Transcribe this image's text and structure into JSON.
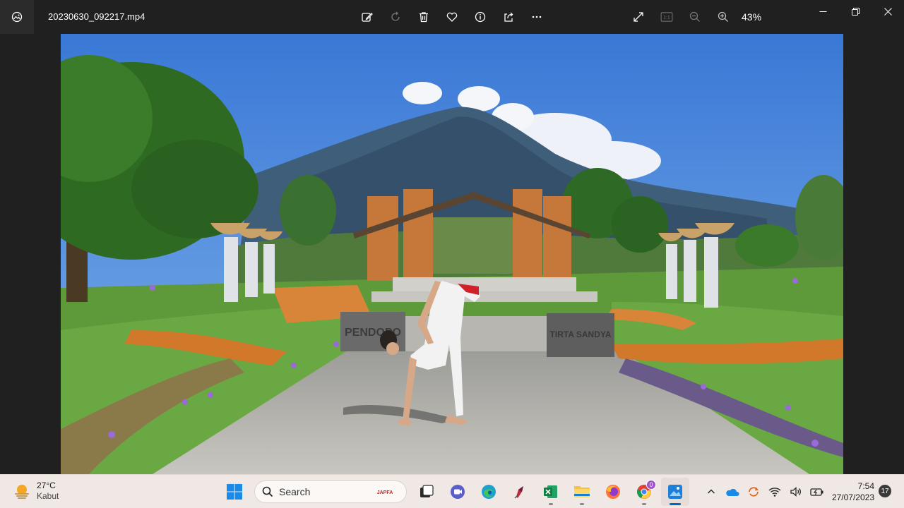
{
  "titlebar": {
    "filename": "20230630_092217.mp4",
    "zoom": "43%",
    "actual_size_label": "1:1",
    "toolbar_icons": [
      "edit-icon",
      "rotate-icon",
      "delete-icon",
      "favorite-icon",
      "info-icon",
      "share-icon",
      "more-icon"
    ],
    "window_controls": [
      "minimize",
      "restore",
      "close"
    ]
  },
  "photo": {
    "sign_left": "PENDOPO",
    "sign_right": "TIRTA SANDYA"
  },
  "taskbar": {
    "weather": {
      "temp": "27°C",
      "condition": "Kabut"
    },
    "search_label": "Search",
    "search_brand": "JAPFA",
    "chrome_badge": "0",
    "clock": {
      "time": "7:54",
      "date": "27/07/2023"
    },
    "notifications": "17"
  },
  "colors": {
    "accent": "#0067c0",
    "titlebar_bg": "#202020",
    "taskbar_bg": "#f0e8e4"
  }
}
